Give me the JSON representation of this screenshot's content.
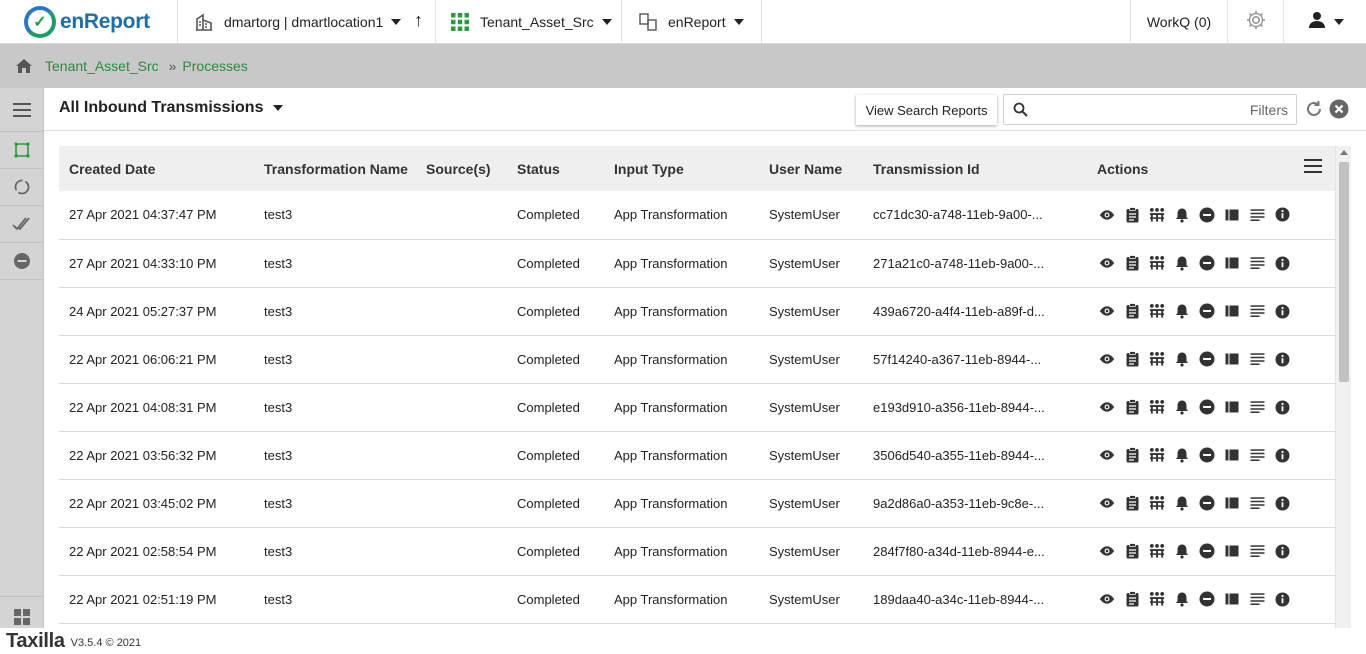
{
  "app": {
    "logo_text": "enReport"
  },
  "topbar": {
    "org_selector": "dmartorg | dmartlocation1",
    "asset_selector": "Tenant_Asset_Src",
    "app_selector": "enReport",
    "workq_label": "WorkQ (0)"
  },
  "breadcrumb": {
    "items": [
      "Tenant_Asset_Src",
      "Processes"
    ],
    "separator": "»"
  },
  "view": {
    "title": "All Inbound Transmissions",
    "view_search_reports_label": "View Search Reports",
    "search_placeholder": "",
    "filters_label": "Filters"
  },
  "table": {
    "columns": [
      "Created Date",
      "Transformation Name",
      "Source(s)",
      "Status",
      "Input Type",
      "User Name",
      "Transmission Id",
      "Actions"
    ],
    "rows": [
      {
        "created_date": "27 Apr 2021 04:37:47 PM",
        "transformation_name": "test3",
        "sources": "",
        "status": "Completed",
        "input_type": "App Transformation",
        "user_name": "SystemUser",
        "transmission_id": "cc71dc30-a748-11eb-9a00-..."
      },
      {
        "created_date": "27 Apr 2021 04:33:10 PM",
        "transformation_name": "test3",
        "sources": "",
        "status": "Completed",
        "input_type": "App Transformation",
        "user_name": "SystemUser",
        "transmission_id": "271a21c0-a748-11eb-9a00-..."
      },
      {
        "created_date": "24 Apr 2021 05:27:37 PM",
        "transformation_name": "test3",
        "sources": "",
        "status": "Completed",
        "input_type": "App Transformation",
        "user_name": "SystemUser",
        "transmission_id": "439a6720-a4f4-11eb-a89f-d..."
      },
      {
        "created_date": "22 Apr 2021 06:06:21 PM",
        "transformation_name": "test3",
        "sources": "",
        "status": "Completed",
        "input_type": "App Transformation",
        "user_name": "SystemUser",
        "transmission_id": "57f14240-a367-11eb-8944-..."
      },
      {
        "created_date": "22 Apr 2021 04:08:31 PM",
        "transformation_name": "test3",
        "sources": "",
        "status": "Completed",
        "input_type": "App Transformation",
        "user_name": "SystemUser",
        "transmission_id": "e193d910-a356-11eb-8944-..."
      },
      {
        "created_date": "22 Apr 2021 03:56:32 PM",
        "transformation_name": "test3",
        "sources": "",
        "status": "Completed",
        "input_type": "App Transformation",
        "user_name": "SystemUser",
        "transmission_id": "3506d540-a355-11eb-8944-..."
      },
      {
        "created_date": "22 Apr 2021 03:45:02 PM",
        "transformation_name": "test3",
        "sources": "",
        "status": "Completed",
        "input_type": "App Transformation",
        "user_name": "SystemUser",
        "transmission_id": "9a2d86a0-a353-11eb-9c8e-..."
      },
      {
        "created_date": "22 Apr 2021 02:58:54 PM",
        "transformation_name": "test3",
        "sources": "",
        "status": "Completed",
        "input_type": "App Transformation",
        "user_name": "SystemUser",
        "transmission_id": "284f7f80-a34d-11eb-8944-e..."
      },
      {
        "created_date": "22 Apr 2021 02:51:19 PM",
        "transformation_name": "test3",
        "sources": "",
        "status": "Completed",
        "input_type": "App Transformation",
        "user_name": "SystemUser",
        "transmission_id": "189daa40-a34c-11eb-8944-..."
      }
    ],
    "row_action_icons": [
      "eye-icon",
      "clipboard-icon",
      "network-icon",
      "bell-icon",
      "minus-circle-icon",
      "table-icon",
      "lines-icon",
      "info-icon"
    ]
  },
  "footer": {
    "brand": "Taxilla",
    "version": "V3.5.4 © 2021"
  },
  "colors": {
    "brand_green": "#2b9b3f",
    "brand_blue": "#1e6fa8",
    "crumb_bar": "#c8c8c8",
    "sidebar": "#d4d4d4"
  }
}
